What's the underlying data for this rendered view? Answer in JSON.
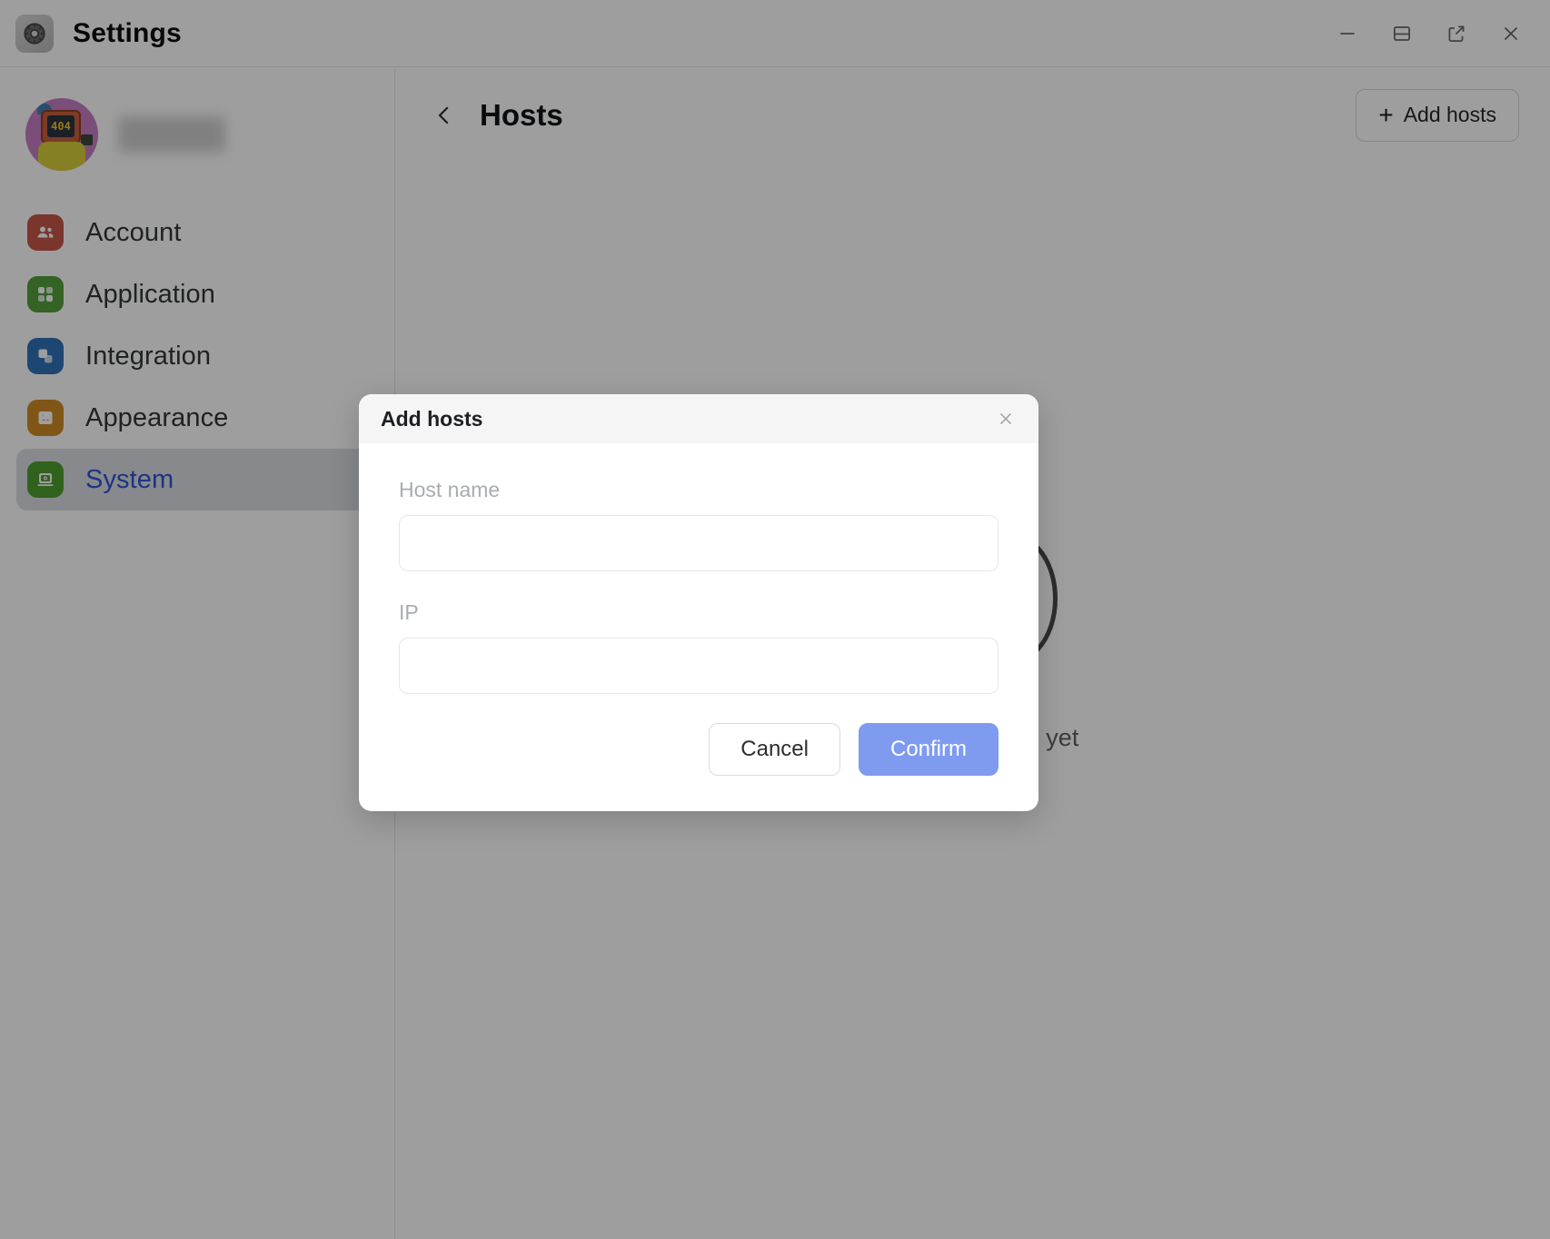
{
  "window": {
    "title": "Settings",
    "app_icon": "gear-icon",
    "controls": [
      {
        "name": "minimize",
        "icon": "minimize-icon"
      },
      {
        "name": "maximize",
        "icon": "restore-window-icon"
      },
      {
        "name": "popout",
        "icon": "external-link-icon"
      },
      {
        "name": "close",
        "icon": "close-icon"
      }
    ]
  },
  "sidebar": {
    "profile": {
      "avatar_icon": "user-avatar",
      "avatar_badge_text": "404",
      "avatar_bg": "#c77fc4",
      "username": ""
    },
    "items": [
      {
        "label": "Account",
        "icon": "people-icon",
        "color": "#c5574a",
        "selected": false
      },
      {
        "label": "Application",
        "icon": "grid-apps-icon",
        "color": "#55a03c",
        "selected": false
      },
      {
        "label": "Integration",
        "icon": "puzzle-link-icon",
        "color": "#2f72b8",
        "selected": false
      },
      {
        "label": "Appearance",
        "icon": "image-icon",
        "color": "#cf8c24",
        "selected": false
      },
      {
        "label": "System",
        "icon": "laptop-gear-icon",
        "color": "#4f9e2f",
        "selected": true
      }
    ],
    "selected_text_color": "#2f54d4",
    "selected_bg_color": "#dadde3"
  },
  "main": {
    "back_icon": "chevron-left-icon",
    "title": "Hosts",
    "add_button": {
      "label": "Add hosts",
      "icon": "plus-icon"
    },
    "empty_state": {
      "illustration": "no-signal-illustration",
      "text": "No hosts added yet"
    }
  },
  "modal": {
    "title": "Add hosts",
    "close_icon": "close-icon",
    "fields": [
      {
        "label": "Host name",
        "value": "",
        "placeholder": ""
      },
      {
        "label": "IP",
        "value": "",
        "placeholder": ""
      }
    ],
    "cancel_label": "Cancel",
    "confirm_label": "Confirm",
    "confirm_color": "#7e9bf0"
  }
}
